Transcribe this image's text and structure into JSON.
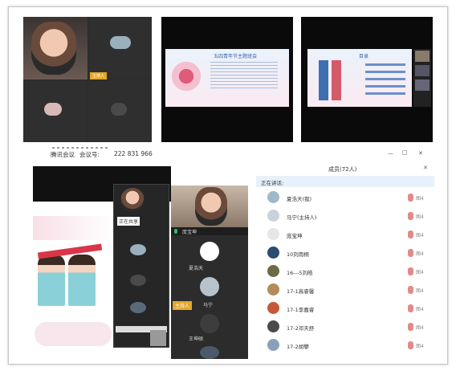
{
  "meeting": {
    "title": "腾讯会议",
    "id_label": "会议号:",
    "id": "222 831 966",
    "window_controls": [
      "—",
      "□",
      "✕"
    ]
  },
  "top_left": {
    "tiles": [
      {
        "label": ""
      },
      {
        "label": ""
      },
      {
        "label": ""
      },
      {
        "label": ""
      }
    ]
  },
  "slides": {
    "slide1_title": "五四青年节主题班会",
    "slide2_title": "目录"
  },
  "bottom_left": {
    "side_host_label": "主持人",
    "side_names": [
      "庞宝坤",
      "夏浩天",
      "马宁",
      "王坤硕"
    ],
    "inner_label": "正在共享"
  },
  "members": {
    "header": "成员(72人)",
    "speaking": "正在讲话:",
    "items": [
      {
        "name": "夏浩天(我)",
        "avatar": "#9fb9c8"
      },
      {
        "name": "马宁(主持人)",
        "avatar": "#c7d3d9"
      },
      {
        "name": "庞宝坤",
        "avatar": "#e6e6e6"
      },
      {
        "name": "10刘雨桐",
        "avatar": "#2d4c70"
      },
      {
        "name": "16---5刘皓",
        "avatar": "#6b6b4a"
      },
      {
        "name": "17-1高睿馨",
        "avatar": "#b38b5a"
      },
      {
        "name": "17-1李嘉睿",
        "avatar": "#c45a3a"
      },
      {
        "name": "17-2邓天舒",
        "avatar": "#4a4a4a"
      },
      {
        "name": "17-2胡攀",
        "avatar": "#8aa0b8"
      }
    ],
    "status_text": "图4"
  },
  "colors": {
    "panel_header": "#e8f1fb",
    "mic_red": "#e28a8a",
    "mic_green": "#3cb371",
    "host_badge": "#e4a72a"
  }
}
